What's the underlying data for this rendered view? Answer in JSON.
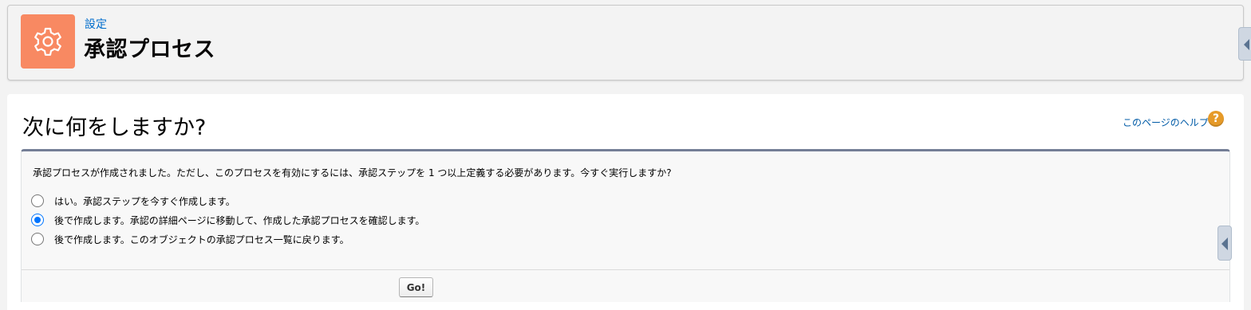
{
  "header": {
    "icon": "gear-icon",
    "breadcrumb": "設定",
    "title": "承認プロセス"
  },
  "main": {
    "heading": "次に何をしますか?",
    "help_link": "このページのヘルプ",
    "help_icon_glyph": "?",
    "message": "承認プロセスが作成されました。ただし、このプロセスを有効にするには、承認ステップを 1 つ以上定義する必要があります。今すぐ実行しますか?",
    "options": [
      {
        "label": "はい。承認ステップを今すぐ作成します。",
        "checked": false
      },
      {
        "label": "後で作成します。承認の詳細ページに移動して、作成した承認プロセスを確認します。",
        "checked": true
      },
      {
        "label": "後で作成します。このオブジェクトの承認プロセス一覧に戻ります。",
        "checked": false
      }
    ],
    "go_button": "Go!"
  },
  "colors": {
    "header_icon_bg": "#f88962",
    "link": "#006dcc",
    "help_icon_bg": "#e69a28",
    "block_top_border": "#747e96",
    "radio_selected": "#0075ff"
  }
}
